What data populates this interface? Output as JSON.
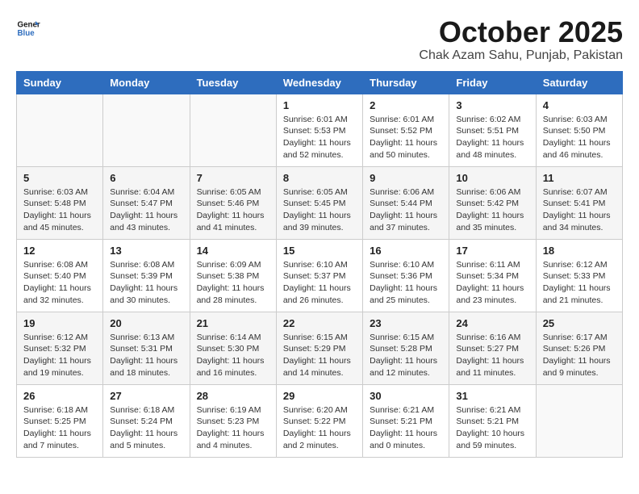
{
  "header": {
    "logo_line1": "General",
    "logo_line2": "Blue",
    "month": "October 2025",
    "location": "Chak Azam Sahu, Punjab, Pakistan"
  },
  "weekdays": [
    "Sunday",
    "Monday",
    "Tuesday",
    "Wednesday",
    "Thursday",
    "Friday",
    "Saturday"
  ],
  "weeks": [
    [
      {
        "day": "",
        "info": ""
      },
      {
        "day": "",
        "info": ""
      },
      {
        "day": "",
        "info": ""
      },
      {
        "day": "1",
        "info": "Sunrise: 6:01 AM\nSunset: 5:53 PM\nDaylight: 11 hours\nand 52 minutes."
      },
      {
        "day": "2",
        "info": "Sunrise: 6:01 AM\nSunset: 5:52 PM\nDaylight: 11 hours\nand 50 minutes."
      },
      {
        "day": "3",
        "info": "Sunrise: 6:02 AM\nSunset: 5:51 PM\nDaylight: 11 hours\nand 48 minutes."
      },
      {
        "day": "4",
        "info": "Sunrise: 6:03 AM\nSunset: 5:50 PM\nDaylight: 11 hours\nand 46 minutes."
      }
    ],
    [
      {
        "day": "5",
        "info": "Sunrise: 6:03 AM\nSunset: 5:48 PM\nDaylight: 11 hours\nand 45 minutes."
      },
      {
        "day": "6",
        "info": "Sunrise: 6:04 AM\nSunset: 5:47 PM\nDaylight: 11 hours\nand 43 minutes."
      },
      {
        "day": "7",
        "info": "Sunrise: 6:05 AM\nSunset: 5:46 PM\nDaylight: 11 hours\nand 41 minutes."
      },
      {
        "day": "8",
        "info": "Sunrise: 6:05 AM\nSunset: 5:45 PM\nDaylight: 11 hours\nand 39 minutes."
      },
      {
        "day": "9",
        "info": "Sunrise: 6:06 AM\nSunset: 5:44 PM\nDaylight: 11 hours\nand 37 minutes."
      },
      {
        "day": "10",
        "info": "Sunrise: 6:06 AM\nSunset: 5:42 PM\nDaylight: 11 hours\nand 35 minutes."
      },
      {
        "day": "11",
        "info": "Sunrise: 6:07 AM\nSunset: 5:41 PM\nDaylight: 11 hours\nand 34 minutes."
      }
    ],
    [
      {
        "day": "12",
        "info": "Sunrise: 6:08 AM\nSunset: 5:40 PM\nDaylight: 11 hours\nand 32 minutes."
      },
      {
        "day": "13",
        "info": "Sunrise: 6:08 AM\nSunset: 5:39 PM\nDaylight: 11 hours\nand 30 minutes."
      },
      {
        "day": "14",
        "info": "Sunrise: 6:09 AM\nSunset: 5:38 PM\nDaylight: 11 hours\nand 28 minutes."
      },
      {
        "day": "15",
        "info": "Sunrise: 6:10 AM\nSunset: 5:37 PM\nDaylight: 11 hours\nand 26 minutes."
      },
      {
        "day": "16",
        "info": "Sunrise: 6:10 AM\nSunset: 5:36 PM\nDaylight: 11 hours\nand 25 minutes."
      },
      {
        "day": "17",
        "info": "Sunrise: 6:11 AM\nSunset: 5:34 PM\nDaylight: 11 hours\nand 23 minutes."
      },
      {
        "day": "18",
        "info": "Sunrise: 6:12 AM\nSunset: 5:33 PM\nDaylight: 11 hours\nand 21 minutes."
      }
    ],
    [
      {
        "day": "19",
        "info": "Sunrise: 6:12 AM\nSunset: 5:32 PM\nDaylight: 11 hours\nand 19 minutes."
      },
      {
        "day": "20",
        "info": "Sunrise: 6:13 AM\nSunset: 5:31 PM\nDaylight: 11 hours\nand 18 minutes."
      },
      {
        "day": "21",
        "info": "Sunrise: 6:14 AM\nSunset: 5:30 PM\nDaylight: 11 hours\nand 16 minutes."
      },
      {
        "day": "22",
        "info": "Sunrise: 6:15 AM\nSunset: 5:29 PM\nDaylight: 11 hours\nand 14 minutes."
      },
      {
        "day": "23",
        "info": "Sunrise: 6:15 AM\nSunset: 5:28 PM\nDaylight: 11 hours\nand 12 minutes."
      },
      {
        "day": "24",
        "info": "Sunrise: 6:16 AM\nSunset: 5:27 PM\nDaylight: 11 hours\nand 11 minutes."
      },
      {
        "day": "25",
        "info": "Sunrise: 6:17 AM\nSunset: 5:26 PM\nDaylight: 11 hours\nand 9 minutes."
      }
    ],
    [
      {
        "day": "26",
        "info": "Sunrise: 6:18 AM\nSunset: 5:25 PM\nDaylight: 11 hours\nand 7 minutes."
      },
      {
        "day": "27",
        "info": "Sunrise: 6:18 AM\nSunset: 5:24 PM\nDaylight: 11 hours\nand 5 minutes."
      },
      {
        "day": "28",
        "info": "Sunrise: 6:19 AM\nSunset: 5:23 PM\nDaylight: 11 hours\nand 4 minutes."
      },
      {
        "day": "29",
        "info": "Sunrise: 6:20 AM\nSunset: 5:22 PM\nDaylight: 11 hours\nand 2 minutes."
      },
      {
        "day": "30",
        "info": "Sunrise: 6:21 AM\nSunset: 5:21 PM\nDaylight: 11 hours\nand 0 minutes."
      },
      {
        "day": "31",
        "info": "Sunrise: 6:21 AM\nSunset: 5:21 PM\nDaylight: 10 hours\nand 59 minutes."
      },
      {
        "day": "",
        "info": ""
      }
    ]
  ]
}
